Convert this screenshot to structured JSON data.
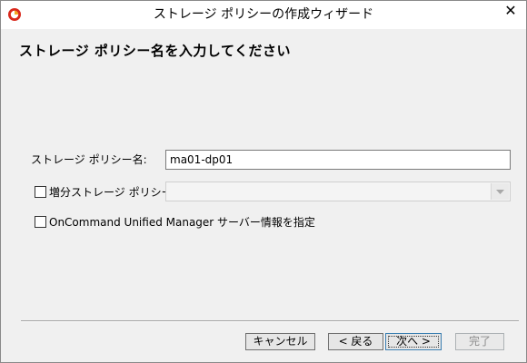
{
  "window": {
    "title": "ストレージ ポリシーの作成ウィザード",
    "close_glyph": "✕"
  },
  "header": {
    "heading": "ストレージ ポリシー名を入力してください"
  },
  "form": {
    "policy_name_label": "ストレージ ポリシー名:",
    "policy_name_value": "ma01-dp01",
    "incremental_label": "増分ストレージ ポリシー",
    "incremental_checked": false,
    "incremental_combo_value": "",
    "oncommand_label": "OnCommand Unified Manager サーバー情報を指定",
    "oncommand_checked": false
  },
  "buttons": {
    "cancel": "キャンセル",
    "back": "< 戻る",
    "next": "次へ >",
    "finish": "完了"
  },
  "icons": {
    "app": "app-logo-icon",
    "close": "close-icon",
    "combo_arrow": "chevron-down-icon"
  },
  "colors": {
    "accent": "#cc2a1f",
    "default_button_border": "#3c7fb1"
  }
}
